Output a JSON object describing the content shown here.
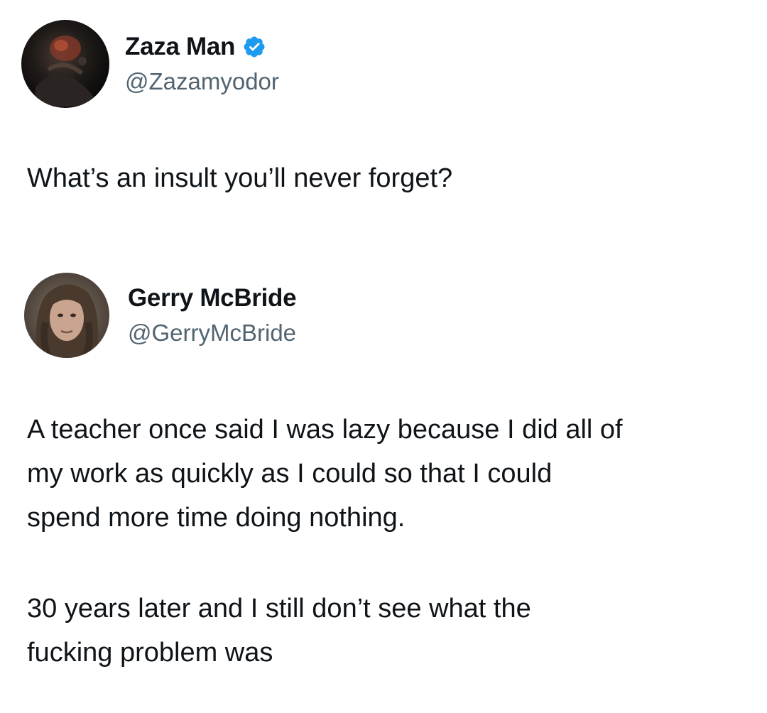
{
  "original_tweet": {
    "author": {
      "display_name": "Zaza Man",
      "handle": "@Zazamyodor",
      "verified": true,
      "verified_badge_color": "#1d9bf0"
    },
    "text": "What’s an insult you’ll never forget?"
  },
  "reply_tweet": {
    "author": {
      "display_name": "Gerry McBride",
      "handle": "@GerryMcBride",
      "verified": false
    },
    "paragraphs": [
      "A teacher once said I was lazy because I did all of\nmy work as quickly as I could so that I could\nspend more time doing nothing.",
      "30 years later and I still don’t see what the\nfucking problem was"
    ]
  },
  "colors": {
    "text_primary": "#0f1419",
    "text_secondary": "#536471",
    "background": "#ffffff"
  }
}
